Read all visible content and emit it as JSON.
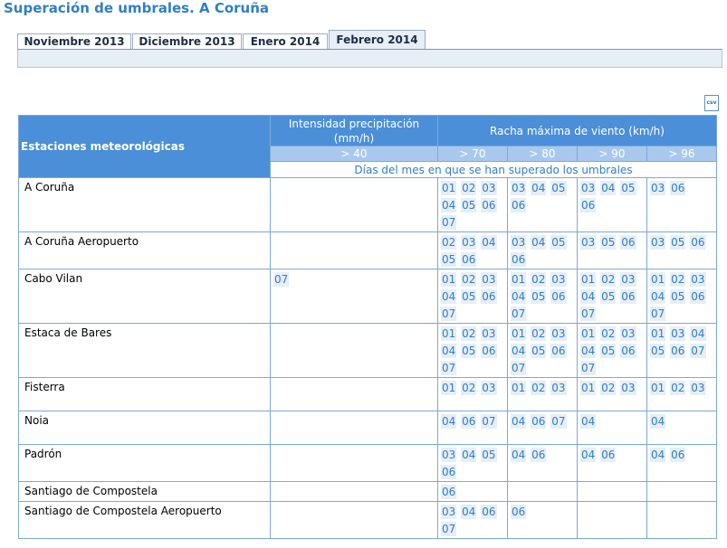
{
  "page_title": "Superación de umbrales. A Coruña",
  "tabs": [
    "Noviembre 2013",
    "Diciembre 2013",
    "Enero 2014",
    "Febrero 2014"
  ],
  "active_tab": "Febrero 2014",
  "csv_icon_label": "csv",
  "table": {
    "stations_header": "Estaciones meteorológicas",
    "groups": [
      {
        "label": "Intensidad precipitación (mm/h)",
        "thresholds": [
          "> 40"
        ]
      },
      {
        "label": "Racha máxima de viento (km/h)",
        "thresholds": [
          "> 70",
          "> 80",
          "> 90",
          "> 96"
        ]
      }
    ],
    "days_caption": "Días del mes en que se han superado los umbrales",
    "rows": [
      {
        "station": "A Coruña",
        "cells": [
          [],
          [
            "01",
            "02",
            "03",
            "04",
            "05",
            "06",
            "07"
          ],
          [
            "03",
            "04",
            "05",
            "06"
          ],
          [
            "03",
            "04",
            "05",
            "06"
          ],
          [
            "03",
            "06"
          ]
        ]
      },
      {
        "station": "A Coruña Aeropuerto",
        "cells": [
          [],
          [
            "02",
            "03",
            "04",
            "05",
            "06"
          ],
          [
            "03",
            "04",
            "05",
            "06"
          ],
          [
            "03",
            "05",
            "06"
          ],
          [
            "03",
            "05",
            "06"
          ]
        ]
      },
      {
        "station": "Cabo Vilan",
        "cells": [
          [
            "07"
          ],
          [
            "01",
            "02",
            "03",
            "04",
            "05",
            "06",
            "07"
          ],
          [
            "01",
            "02",
            "03",
            "04",
            "05",
            "06",
            "07"
          ],
          [
            "01",
            "02",
            "03",
            "04",
            "05",
            "06",
            "07"
          ],
          [
            "01",
            "02",
            "03",
            "04",
            "05",
            "06",
            "07"
          ]
        ]
      },
      {
        "station": "Estaca de Bares",
        "cells": [
          [],
          [
            "01",
            "02",
            "03",
            "04",
            "05",
            "06",
            "07"
          ],
          [
            "01",
            "02",
            "03",
            "04",
            "05",
            "06",
            "07"
          ],
          [
            "01",
            "02",
            "03",
            "04",
            "05",
            "06",
            "07"
          ],
          [
            "01",
            "03",
            "04",
            "05",
            "06",
            "07"
          ]
        ]
      },
      {
        "station": "Fisterra",
        "cells": [
          [],
          [
            "01",
            "02",
            "03"
          ],
          [
            "01",
            "02",
            "03"
          ],
          [
            "01",
            "02",
            "03"
          ],
          [
            "01",
            "02",
            "03"
          ]
        ]
      },
      {
        "station": "Noia",
        "cells": [
          [],
          [
            "04",
            "06",
            "07"
          ],
          [
            "04",
            "06",
            "07"
          ],
          [
            "04"
          ],
          [
            "04"
          ]
        ]
      },
      {
        "station": "Padrón",
        "cells": [
          [],
          [
            "03",
            "04",
            "05",
            "06"
          ],
          [
            "04",
            "06"
          ],
          [
            "04",
            "06"
          ],
          [
            "04",
            "06"
          ]
        ]
      },
      {
        "station": "Santiago de Compostela",
        "cells": [
          [],
          [
            "06"
          ],
          [],
          [],
          []
        ]
      },
      {
        "station": "Santiago de Compostela Aeropuerto",
        "cells": [
          [],
          [
            "03",
            "04",
            "06",
            "07"
          ],
          [
            "06"
          ],
          [],
          []
        ]
      }
    ]
  }
}
